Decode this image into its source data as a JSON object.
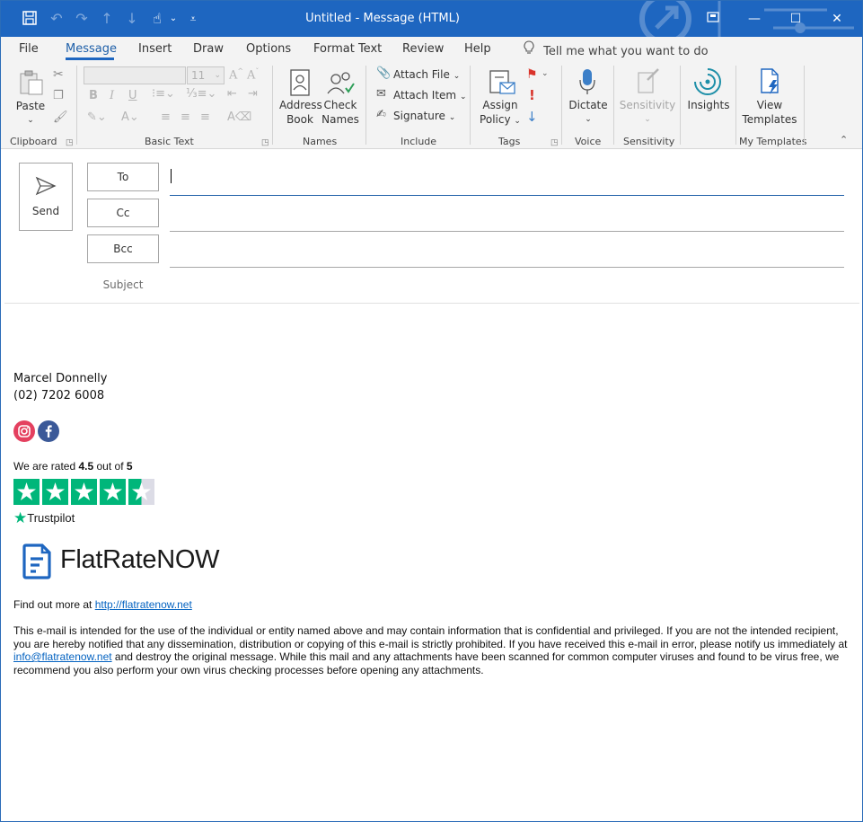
{
  "window": {
    "title": "Untitled  -  Message (HTML)"
  },
  "menu": {
    "tabs": [
      "File",
      "Message",
      "Insert",
      "Draw",
      "Options",
      "Format Text",
      "Review",
      "Help"
    ],
    "tell_me": "Tell me what you want to do"
  },
  "ribbon": {
    "clipboard": {
      "paste": "Paste",
      "group": "Clipboard"
    },
    "basic_text": {
      "font_size": "11",
      "bold": "B",
      "italic": "I",
      "underline": "U",
      "group": "Basic Text"
    },
    "names": {
      "address_book_1": "Address",
      "address_book_2": "Book",
      "check_names_1": "Check",
      "check_names_2": "Names",
      "group": "Names"
    },
    "include": {
      "attach_file": "Attach File",
      "attach_item": "Attach Item",
      "signature": "Signature",
      "group": "Include"
    },
    "tags": {
      "assign_1": "Assign",
      "assign_2": "Policy",
      "group": "Tags"
    },
    "voice": {
      "dictate": "Dictate",
      "group": "Voice"
    },
    "sensitivity": {
      "button": "Sensitivity",
      "group": "Sensitivity"
    },
    "insights": {
      "button": "Insights"
    },
    "templates": {
      "view_1": "View",
      "view_2": "Templates",
      "group": "My Templates"
    }
  },
  "compose": {
    "send": "Send",
    "to": "To",
    "cc": "Cc",
    "bcc": "Bcc",
    "subject": "Subject"
  },
  "signature": {
    "name": "Marcel Donnelly",
    "phone": "(02) 7202 6008",
    "rating_prefix": "We are rated ",
    "rating_value": "4.5",
    "rating_mid": " out of ",
    "rating_max": "5",
    "rating": 4.5,
    "rating_scale": 5,
    "trustpilot": "Trustpilot",
    "company": "FlatRateNOW",
    "find_out": "Find out more at ",
    "website": "http://flatratenow.net",
    "disclaimer_1": "This e-mail is intended for the use of the individual or entity named above and may contain information that is confidential and privileged. If you are not the intended recipient, you are hereby notified that any dissemination, distribution or copying of this e-mail is strictly prohibited. If you have received this e-mail in error, please notify us immediately at ",
    "email": "info@flatratenow.net",
    "disclaimer_2": " and destroy the original message. While this mail and any attachments have been scanned for common computer viruses and found to be virus free, we recommend you also perform your own virus checking processes before opening any attachments."
  },
  "colors": {
    "accent": "#1e66c0",
    "trustpilot_green": "#00b67a",
    "instagram": "#e4405f",
    "facebook": "#3b5998",
    "link": "#0563c1"
  }
}
